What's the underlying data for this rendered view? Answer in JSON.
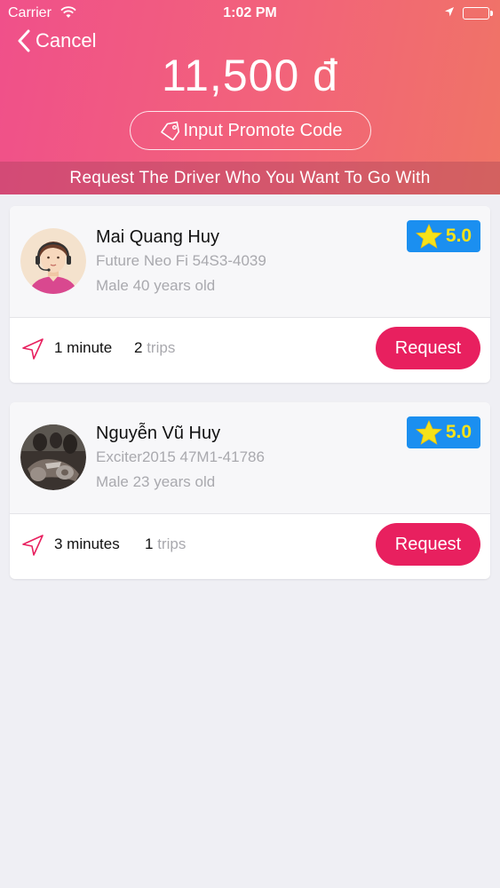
{
  "status_bar": {
    "carrier": "Carrier",
    "time": "1:02 PM",
    "icons": [
      "wifi-icon",
      "location-arrow-icon",
      "battery-icon"
    ]
  },
  "header": {
    "cancel_label": "Cancel",
    "price": "11,500 đ",
    "promo_label": "Input Promote Code",
    "request_banner": "Request The Driver Who You Want To Go With"
  },
  "drivers": [
    {
      "name": "Mai Quang Huy",
      "vehicle": "Future Neo Fi 54S3-4039",
      "info": "Male 40 years old",
      "rating": "5.0",
      "eta": "1 minute",
      "trips_count": "2",
      "trips_unit": "trips",
      "request_label": "Request",
      "avatar": "female-operator-avatar"
    },
    {
      "name": "Nguyễn Vũ Huy",
      "vehicle": "Exciter2015 47M1-41786",
      "info": "Male 23 years old",
      "rating": "5.0",
      "eta": "3 minutes",
      "trips_count": "1",
      "trips_unit": "trips",
      "request_label": "Request",
      "avatar": "motorcycle-photo-avatar"
    }
  ],
  "colors": {
    "header_gradient_start": "#f0508a",
    "header_gradient_end": "#f07466",
    "accent": "#e8205f",
    "rating_bg": "#1b8ff0",
    "rating_star": "#f6e21a",
    "background": "#efeff4"
  }
}
